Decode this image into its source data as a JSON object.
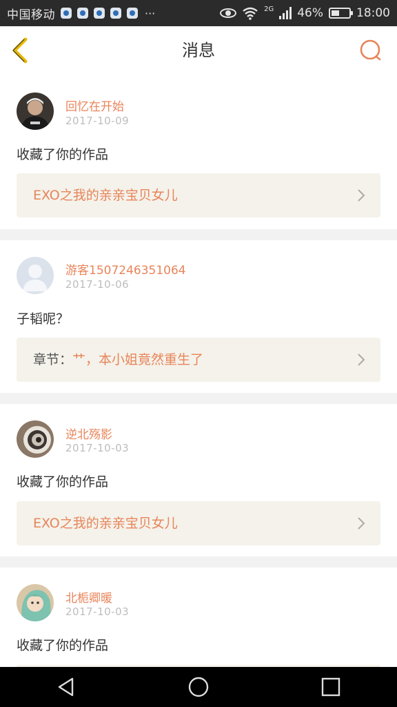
{
  "status_bar": {
    "carrier": "中国移动",
    "network": "2G",
    "battery": "46%",
    "time": "18:00",
    "more": "···"
  },
  "header": {
    "title": "消息"
  },
  "messages": [
    {
      "username": "回忆在开始",
      "date": "2017-10-09",
      "text": "收藏了你的作品",
      "ref_prefix": "",
      "ref_title": "EXO之我的亲亲宝贝女儿"
    },
    {
      "username": "游客15072463​51064",
      "date": "2017-10-06",
      "text": "子韬呢？",
      "ref_prefix": "章节：",
      "ref_title": "艹，本小姐竟然重生了"
    },
    {
      "username": "逆北殇影",
      "date": "2017-10-03",
      "text": "收藏了你的作品",
      "ref_prefix": "",
      "ref_title": "EXO之我的亲亲宝贝女儿"
    },
    {
      "username": "北栀卿暖",
      "date": "2017-10-03",
      "text": "收藏了你的作品",
      "ref_prefix": "",
      "ref_title": ""
    }
  ],
  "colors": {
    "accent": "#e8845a",
    "back_arrow": "#e8b800",
    "ref_bg": "#f4f2ea"
  },
  "icons": {
    "back": "chevron-left-icon",
    "search": "search-icon",
    "chevron": "chevron-right-icon",
    "nav_back": "triangle-back-icon",
    "nav_home": "circle-home-icon",
    "nav_recent": "square-recent-icon"
  }
}
